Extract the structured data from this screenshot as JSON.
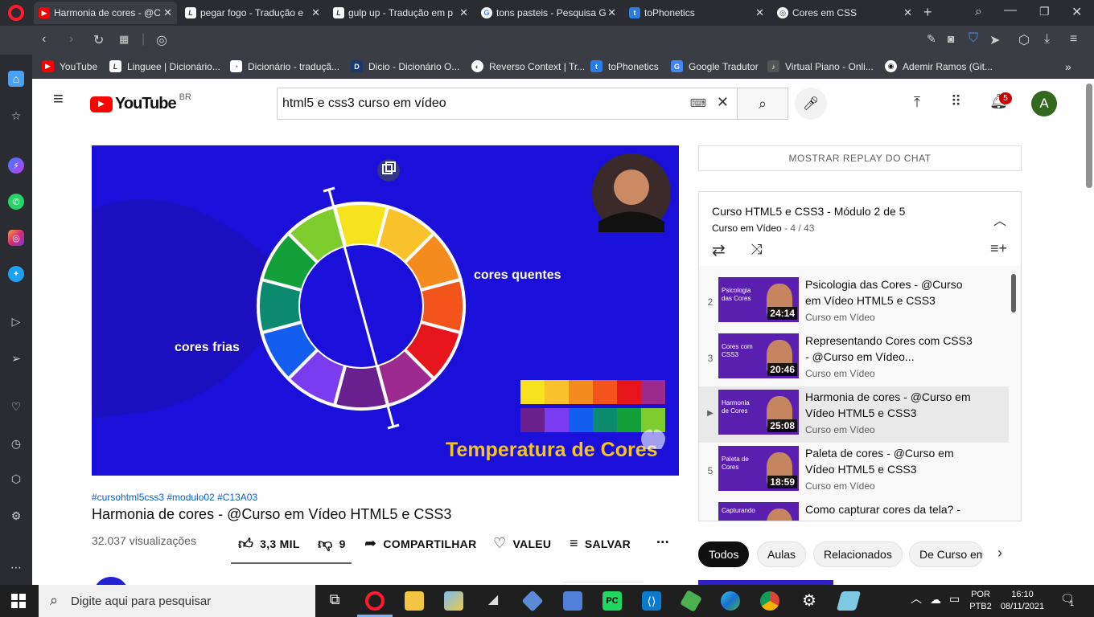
{
  "browser": {
    "tabs": [
      {
        "label": "Harmonia de cores - @C",
        "active": true
      },
      {
        "label": "pegar fogo - Tradução e"
      },
      {
        "label": "gulp up - Tradução em p"
      },
      {
        "label": "tons pasteis - Pesquisa G"
      },
      {
        "label": "toPhonetics"
      },
      {
        "label": "Cores em CSS"
      }
    ],
    "new_tab": "+",
    "bookmarks": [
      "YouTube",
      "Linguee | Dicionário...",
      "Dicionário - traduçã...",
      "Dicio - Dicionário O...",
      "Reverso Context | Tr...",
      "toPhonetics",
      "Google Tradutor",
      "Virtual Piano - Onli...",
      "Ademir Ramos (Git..."
    ],
    "bookmarks_more": "»"
  },
  "youtube": {
    "logo_text": "YouTube",
    "region": "BR",
    "search_value": "html5 e css3 curso em vídeo",
    "notif_count": "5",
    "avatar_letter": "A",
    "video": {
      "hashtags": "#cursohtml5css3 #modulo02 #C13A03",
      "title": "Harmonia de cores - @Curso em Vídeo HTML5 e CSS3",
      "views": "32.037 visualizações",
      "likes": "3,3 MIL",
      "dislikes": "9",
      "share": "COMPARTILHAR",
      "thanks": "VALEU",
      "save": "SALVAR",
      "more": "...",
      "overlay": {
        "warm_label": "cores quentes",
        "cold_label": "cores frias",
        "caption": "Temperatura de Cores"
      }
    },
    "chat_replay": "MOSTRAR REPLAY DO CHAT",
    "playlist": {
      "title": "Curso HTML5 e CSS3 - Módulo 2 de 5",
      "channel": "Curso em Vídeo",
      "position": "- 4 / 43",
      "items": [
        {
          "index": "2",
          "title": "Psicologia das Cores - @Curso em Vídeo HTML5 e CSS3",
          "channel": "Curso em Vídeo",
          "duration": "24:14",
          "thumb_text": "Psicologia das Cores"
        },
        {
          "index": "3",
          "title": "Representando Cores com CSS3 - @Curso em Vídeo...",
          "channel": "Curso em Vídeo",
          "duration": "20:46",
          "thumb_text": "Cores com CSS3"
        },
        {
          "index": "▶",
          "title": "Harmonia de cores - @Curso em Vídeo HTML5 e CSS3",
          "channel": "Curso em Vídeo",
          "duration": "25:08",
          "thumb_text": "Harmonia de Cores"
        },
        {
          "index": "5",
          "title": "Paleta de cores - @Curso em Vídeo HTML5 e CSS3",
          "channel": "Curso em Vídeo",
          "duration": "18:59",
          "thumb_text": "Paleta de Cores"
        },
        {
          "index": "",
          "title": "Como capturar cores da tela? -",
          "channel": "",
          "duration": "",
          "thumb_text": "Capturando"
        }
      ]
    },
    "chips": [
      "Todos",
      "Aulas",
      "Relacionados",
      "De Curso em"
    ]
  },
  "taskbar": {
    "search_placeholder": "Digite aqui para pesquisar",
    "lang_top": "POR",
    "lang_bottom": "PTB2",
    "time": "16:10",
    "date": "08/11/2021",
    "notif": "1"
  },
  "colors": {
    "youtube_red": "#ff0000",
    "link_blue": "#065fd4",
    "video_bg": "#1a10d9"
  }
}
